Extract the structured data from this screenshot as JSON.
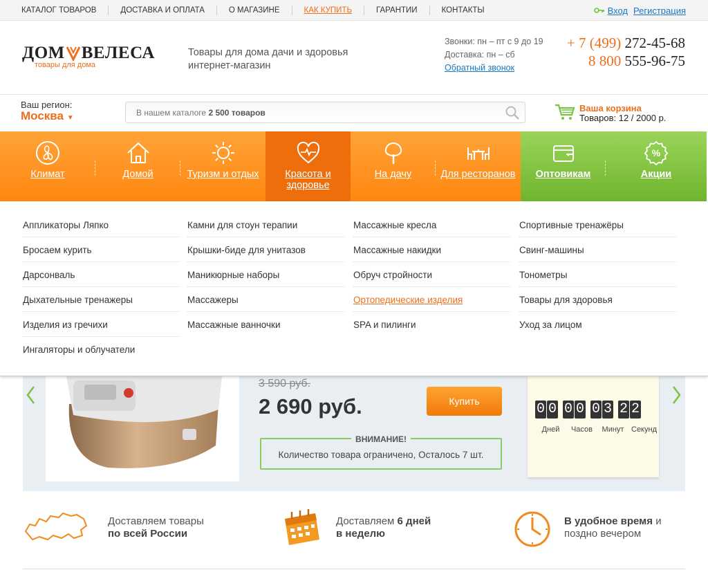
{
  "topnav": {
    "items": [
      "КАТАЛОГ ТОВАРОВ",
      "ДОСТАВКА И ОПЛАТА",
      "О МАГАЗИНЕ",
      "КАК КУПИТЬ",
      "ГАРАНТИИ",
      "КОНТАКТЫ"
    ],
    "login": "Вход",
    "register": "Регистрация"
  },
  "header": {
    "logo_left": "ДОМ",
    "logo_right": "ВЕЛЕСА",
    "logo_sub": "товары для дома",
    "tagline": "Товары для дома дачи и здоровья интернет-магазин",
    "hours": "Звонки: пн – пт с 9 до 19",
    "delivery": "Доставка: пн – сб",
    "callback": "Обратный звонок",
    "phone1_code": "+ 7 (499)",
    "phone1_num": "272-45-68",
    "phone2_code": "8 800",
    "phone2_num": "555-96-75"
  },
  "region": {
    "label": "Ваш регион:",
    "city": "Москва",
    "caret": "▼"
  },
  "search": {
    "placeholder_prefix": "В нашем каталоге",
    "placeholder_count": "2 500 товаров"
  },
  "cart": {
    "title": "Ваша корзина",
    "summary": "Товаров: 12 /  2000 р."
  },
  "categories": [
    {
      "label": "Климат",
      "icon": "fan-icon"
    },
    {
      "label": "Домой",
      "icon": "house-icon"
    },
    {
      "label": "Туризм и отдых",
      "icon": "sun-icon"
    },
    {
      "label": "Красота и здоровье",
      "icon": "heart-pulse-icon"
    },
    {
      "label": "На дачу",
      "icon": "tree-icon"
    },
    {
      "label": "Для ресторанов",
      "icon": "table-icon"
    },
    {
      "label": "Оптовикам",
      "icon": "wallet-icon"
    },
    {
      "label": "Акции",
      "icon": "percent-icon"
    }
  ],
  "dropdown": {
    "col1": [
      "Аппликаторы Ляпко",
      "Бросаем курить",
      "Дарсонваль",
      "Дыхательные тренажеры",
      "Изделия из гречихи",
      "Ингаляторы и облучатели"
    ],
    "col2": [
      "Камни для стоун терапии",
      "Крышки-биде для унитазов",
      "Маникюрные наборы",
      "Массажеры",
      "Массажные ванночки"
    ],
    "col3": [
      "Массажные кресла",
      "Массажные накидки",
      "Обруч стройности",
      "Ортопедические изделия",
      "SPA и пилинги"
    ],
    "col4": [
      "Спортивные тренажёры",
      "Свинг-машины",
      "Тонометры",
      "Товары для здоровья",
      "Уход за лицом"
    ]
  },
  "promo": {
    "old_price": "3 590 руб.",
    "price": "2 690 руб.",
    "buy": "Купить",
    "warning_title": "ВНИМАНИЕ!",
    "warning_text": "Количество товара ограничено, Осталось 7 шт.",
    "timer_digits": [
      "0",
      "0",
      "0",
      "0",
      "0",
      "3",
      "2",
      "2"
    ],
    "timer_labels": [
      "Дней",
      "Часов",
      "Минут",
      "Секунд"
    ]
  },
  "features": [
    {
      "line1": "Доставляем товары",
      "line2": "по всей России"
    },
    {
      "line1a": "Доставляем ",
      "line1b": "6 дней",
      "line2": "в неделю"
    },
    {
      "line1a": "В удобное время",
      "line1b": " и",
      "line2": "поздно вечером"
    }
  ],
  "colors": {
    "orange": "#ee6e1c",
    "green": "#7cc144",
    "link": "#1a77c4"
  }
}
